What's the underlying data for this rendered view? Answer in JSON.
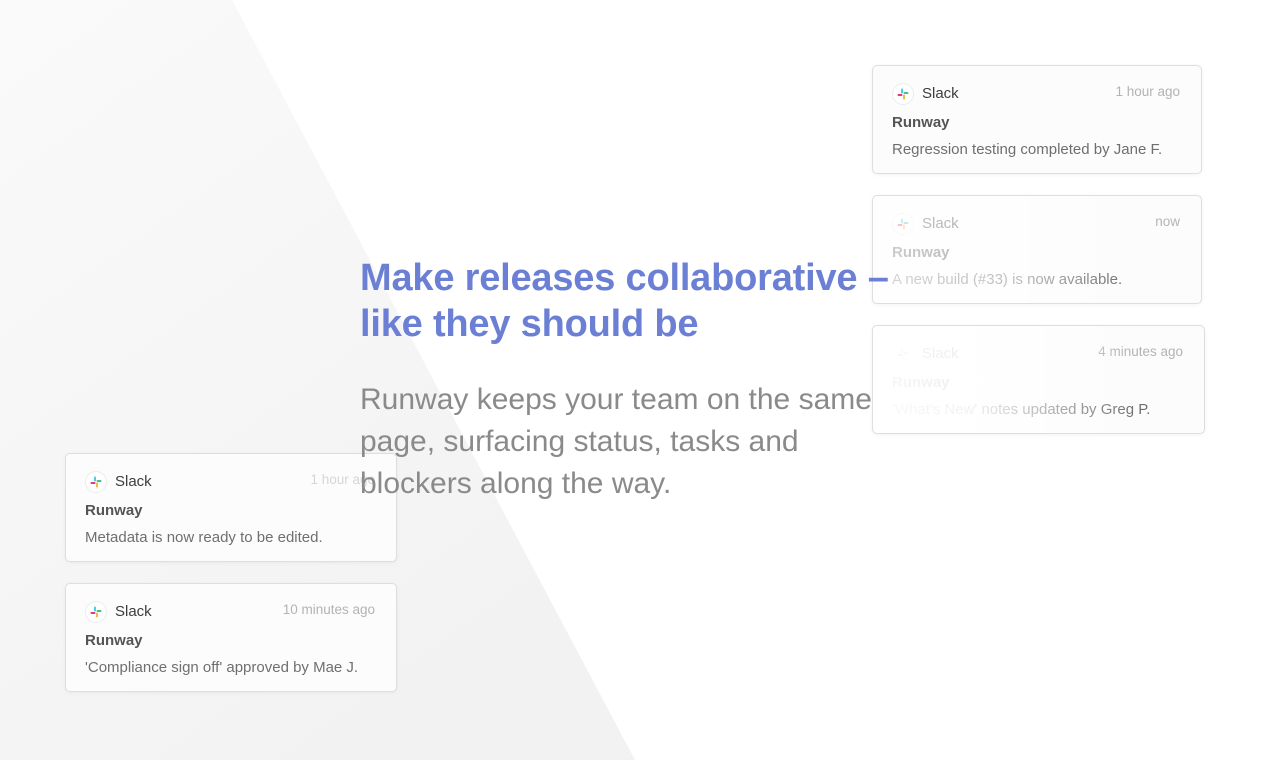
{
  "hero": {
    "headline_line1": "Make releases collaborative –",
    "headline_line2": "like they should be",
    "subtext_line1": "Runway keeps your team on the same",
    "subtext_line2": "page, surfacing status, tasks and",
    "subtext_line3": "blockers along the way."
  },
  "colors": {
    "headline": "#6b7fd4",
    "subtext": "#8a8a8a",
    "card_border": "#dedede",
    "timestamp": "#b3b3b3",
    "slack_blue": "#36c5f0",
    "slack_green": "#2eb67d",
    "slack_yellow": "#ecb22e",
    "slack_red": "#e01e5a"
  },
  "notifications": [
    {
      "app": "Slack",
      "icon": "slack-logo-icon",
      "time": "1 hour ago",
      "title": "Runway",
      "message": "Regression testing completed by Jane F."
    },
    {
      "app": "Slack",
      "icon": "slack-logo-icon",
      "time": "now",
      "title": "Runway",
      "message": "A new build (#33) is now available."
    },
    {
      "app": "Slack",
      "icon": "slack-logo-icon",
      "time": "4 minutes ago",
      "title": "Runway",
      "message": "'What's New' notes updated by Greg P."
    },
    {
      "app": "Slack",
      "icon": "slack-logo-icon",
      "time": "1 hour ago",
      "title": "Runway",
      "message": "Metadata is now ready to be edited."
    },
    {
      "app": "Slack",
      "icon": "slack-logo-icon",
      "time": "10 minutes ago",
      "title": "Runway",
      "message": "'Compliance sign off' approved by Mae J."
    }
  ]
}
